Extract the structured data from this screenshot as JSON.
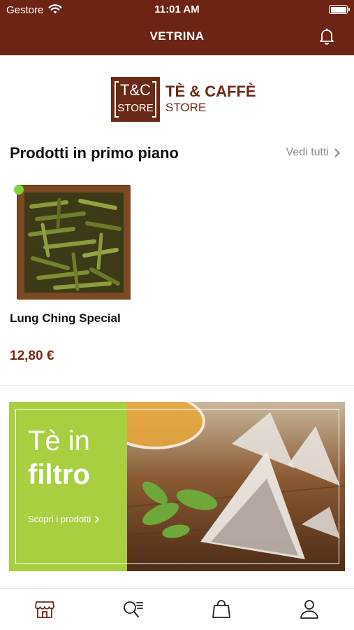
{
  "status_bar": {
    "carrier": "Gestore",
    "time": "11:01 AM",
    "wifi_icon": "wifi-icon",
    "battery_icon": "battery-icon"
  },
  "nav": {
    "title": "VETRINA",
    "bell_icon": "bell-icon"
  },
  "brand": {
    "box_line1": "T&C",
    "box_line2": "STORE",
    "name_line1": "TÈ & CAFFÈ",
    "name_line2": "STORE"
  },
  "featured": {
    "title": "Prodotti in primo piano",
    "see_all": "Vedi tutti",
    "products": [
      {
        "name": "Lung Ching Special",
        "price": "12,80 €"
      }
    ]
  },
  "banner": {
    "line1": "Tè in",
    "line2": "filtro",
    "cta": "Scopri i prodotti"
  },
  "tabbar": {
    "items": [
      {
        "icon": "store-icon"
      },
      {
        "icon": "search-list-icon"
      },
      {
        "icon": "shopping-bag-icon"
      },
      {
        "icon": "user-icon"
      }
    ]
  },
  "colors": {
    "brand": "#6e2414",
    "accent_green": "#a7cf3f",
    "price": "#7a2a14",
    "status_dot": "#7fd43a"
  }
}
